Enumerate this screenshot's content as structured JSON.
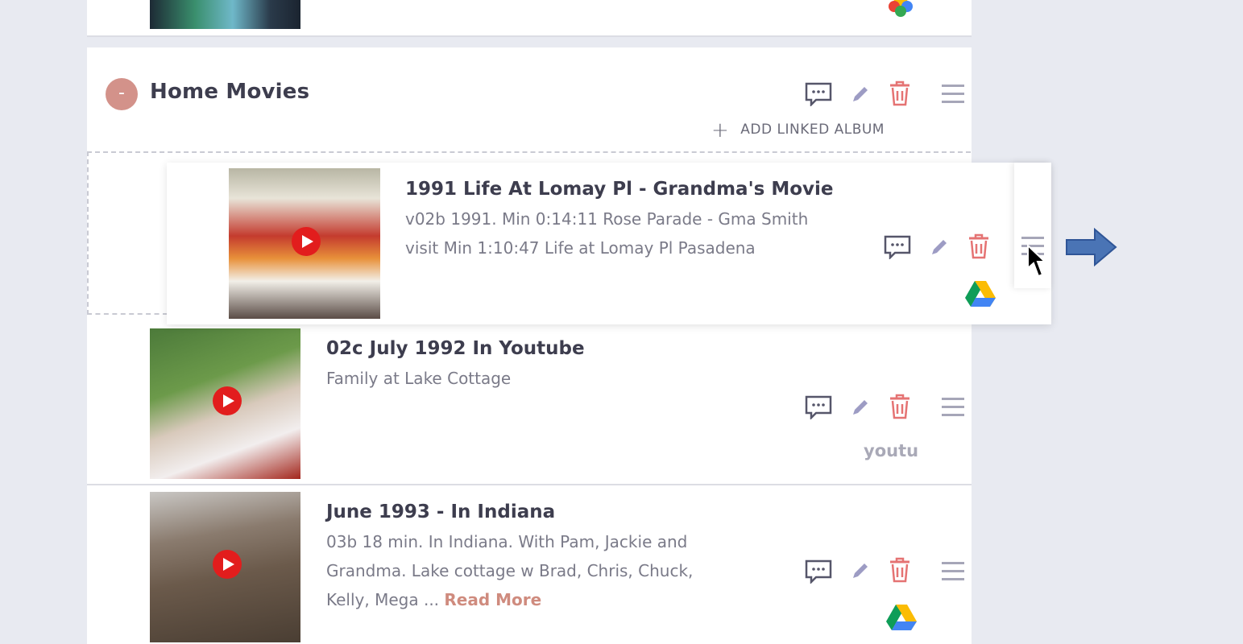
{
  "album": {
    "collapse_symbol": "-",
    "title": "Home Movies",
    "add_linked_label": "ADD LINKED ALBUM",
    "add_icon": "plus-icon"
  },
  "items": [
    {
      "title": "1991 Life At Lomay Pl - Grandma's Movie",
      "desc_lines": [
        "v02b 1991. Min 0:14:11 Rose Parade - Gma Smith",
        "visit Min 1:10:47 Life at Lomay Pl Pasadena"
      ],
      "source_icon": "google-drive-icon",
      "state": "dragging"
    },
    {
      "title": "02c July 1992 In Youtube",
      "desc_lines": [
        "Family at Lake Cottage"
      ],
      "source_text": "youtu"
    },
    {
      "title": "June 1993 - In Indiana",
      "desc_lines": [
        "03b 18 min. In Indiana. With Pam, Jackie and",
        "Grandma. Lake cottage w Brad, Chris, Chuck,",
        "Kelly, Mega ..."
      ],
      "read_more": "Read More",
      "source_icon": "google-drive-icon"
    }
  ],
  "icons": {
    "comment": "comment-icon",
    "edit": "pencil-icon",
    "delete": "trash-icon",
    "drag": "drag-handle-icon",
    "play": "play-icon"
  },
  "colors": {
    "accent": "#d3928a",
    "delete": "#e57373",
    "play": "#e21d1d",
    "arrow": "#4a74b5",
    "background": "#e8eaf1"
  }
}
